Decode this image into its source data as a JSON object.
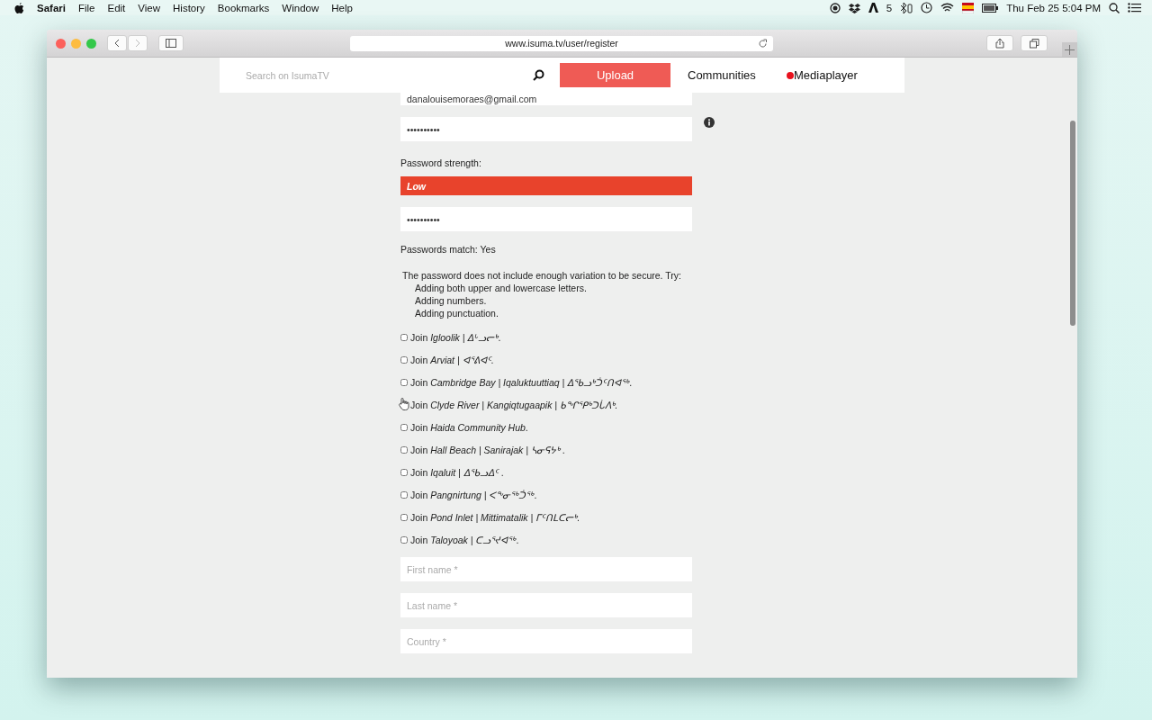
{
  "menubar": {
    "app": "Safari",
    "menus": [
      "File",
      "Edit",
      "View",
      "History",
      "Bookmarks",
      "Window",
      "Help"
    ],
    "badge_count": "5",
    "clock": "Thu Feb 25  5:04 PM"
  },
  "browser": {
    "url": "www.isuma.tv/user/register"
  },
  "site_header": {
    "search_placeholder": "Search on IsumaTV",
    "nav": [
      {
        "label": "Upload",
        "kind": "primary"
      },
      {
        "label": "Communities",
        "kind": "plain"
      },
      {
        "label": "Mediaplayer",
        "kind": "dot",
        "color": "#e8121e"
      }
    ]
  },
  "form": {
    "email_value": "danalouisemoraes@gmail.com",
    "password_value": "••••••••••",
    "strength_label": "Password strength:",
    "strength": "Low",
    "confirm_value": "••••••••••",
    "match": "Passwords match: Yes",
    "advice": {
      "intro": "The password does not include enough variation to be secure. Try:",
      "tips": [
        "Adding both upper and lowercase letters.",
        "Adding numbers.",
        "Adding punctuation."
      ]
    },
    "communities": [
      {
        "label": "Join *Igloolik | ᐃᒡᓗᓕᒃ*.",
        "checked": false
      },
      {
        "label": "Join *Arviat | ᐊᕐᕕᐊᑦ*.",
        "checked": false
      },
      {
        "label": "Join *Cambridge Bay | Iqaluktuuttiaq | ᐃᖃᓗᒃᑑᑦᑎᐊᖅ*.",
        "checked": false
      },
      {
        "label": "Join *Clyde River | Kangiqtugaapik | ᑲᖏᕿᒃᑐᒑᐱᒃ*.",
        "checked": false
      },
      {
        "label": "Join *Haida Community Hub*.",
        "checked": false
      },
      {
        "label": "Join *Hall Beach | Sanirajak | ᓴᓂᕋᔭᒃ* .",
        "checked": false
      },
      {
        "label": "Join *Iqaluit | ᐃᖃᓗᐃᑦ* .",
        "checked": false
      },
      {
        "label": "Join *Pangnirtung | ᐸᖕᓂᖅᑑᖅ*.",
        "checked": false
      },
      {
        "label": "Join *Pond Inlet | Mittimatalik | ᒥᑦᑎᒪᑕᓕᒃ*.",
        "checked": false
      },
      {
        "label": "Join *Taloyoak | ᑕᓗᕐᔪᐊᖅ*.",
        "checked": false
      }
    ],
    "fields": [
      {
        "placeholder": "First name *"
      },
      {
        "placeholder": "Last name *"
      },
      {
        "placeholder": "Country *"
      }
    ]
  }
}
